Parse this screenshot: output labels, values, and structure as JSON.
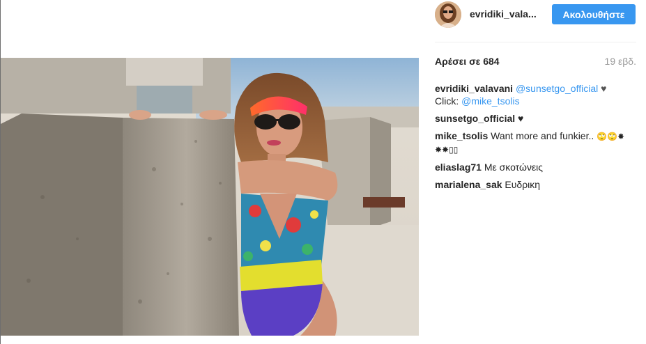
{
  "post": {
    "photo_alt": "",
    "header": {
      "username": "evridiki_vala...",
      "follow_label": "Ακολουθήστε"
    },
    "likes_label": "Αρέσει σε 684",
    "time_label": "19 εβδ.",
    "comments": [
      {
        "author": "evridiki_valavani",
        "mention1": "@sunsetgo_official",
        "heart": "♥",
        "line2_prefix": "Click:",
        "mention2": "@mike_tsolis"
      },
      {
        "author": "sunsetgo_official",
        "heart": "♥"
      },
      {
        "author": "mike_tsolis",
        "text": "Want more and funkier..",
        "emoji_line1": "🙄🙄✸",
        "emoji_line2": "✸✸▯▯"
      },
      {
        "author": "eliaslag71",
        "text": "Με σκοτώνεις"
      },
      {
        "author": "marialena_sak",
        "text": "Ευδρικη"
      }
    ]
  },
  "colors": {
    "accent": "#3897f0",
    "text": "#262626",
    "muted": "#999999"
  },
  "icons": {
    "heart": "heart-icon"
  }
}
